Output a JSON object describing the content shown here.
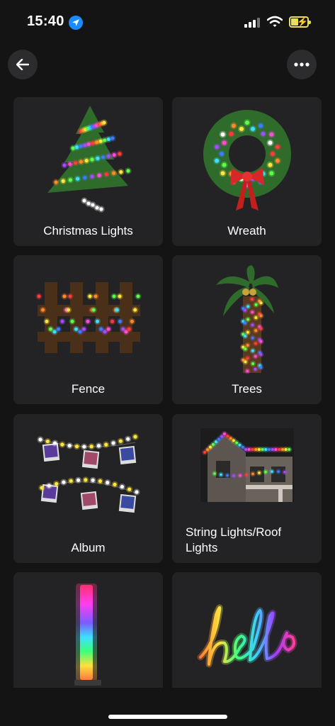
{
  "status": {
    "time": "15:40"
  },
  "header": {
    "back_icon": "arrow-left-icon",
    "more_icon": "ellipsis-icon"
  },
  "categories": [
    {
      "label": "Christmas Lights",
      "icon": "christmas-tree-lights"
    },
    {
      "label": "Wreath",
      "icon": "wreath-lights"
    },
    {
      "label": "Fence",
      "icon": "fence-lights"
    },
    {
      "label": "Trees",
      "icon": "palm-tree-lights"
    },
    {
      "label": "Album",
      "icon": "photo-string-lights"
    },
    {
      "label": "String Lights/Roof Lights",
      "icon": "roof-lights"
    },
    {
      "label": "",
      "icon": "light-bar"
    },
    {
      "label": "",
      "icon": "neon-hello-sign"
    }
  ]
}
